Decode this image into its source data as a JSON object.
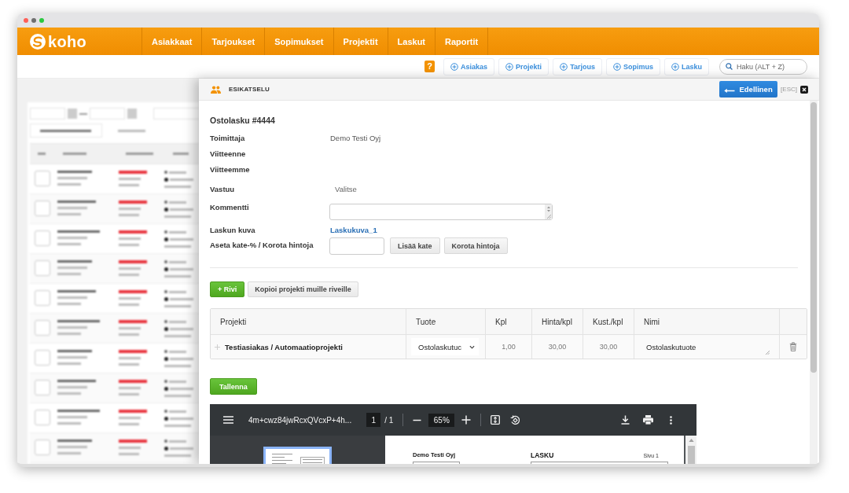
{
  "nav": {
    "logo": "koho",
    "items": [
      "Asiakkaat",
      "Tarjoukset",
      "Sopimukset",
      "Projektit",
      "Laskut",
      "Raportit"
    ]
  },
  "toolbar": {
    "help": "?",
    "quick_add": [
      "Asiakas",
      "Projekti",
      "Tarjous",
      "Sopimus",
      "Lasku"
    ],
    "search": {
      "placeholder": "Haku (ALT + Z)"
    }
  },
  "modal": {
    "title": "ESIKATSELU",
    "back_button": "Edellinen",
    "esc_hint": "[ESC]"
  },
  "form": {
    "heading": "Ostolasku #4444",
    "fields": [
      {
        "kind": "text",
        "label": "Toimittaja",
        "value": "Demo Testi Oyj"
      },
      {
        "kind": "text",
        "label": "Viitteenne"
      },
      {
        "kind": "text",
        "label": "Viitteemme"
      },
      {
        "kind": "select",
        "label": "Vastuu",
        "value": "Valitse"
      },
      {
        "kind": "textarea",
        "label": "Kommentti"
      },
      {
        "kind": "link",
        "label": "Laskun kuva",
        "value": "Laskukuva_1"
      },
      {
        "kind": "margin",
        "label": "Aseta kate-% / Korota hintoja",
        "buttons": [
          "Lisää kate",
          "Korota hintoja"
        ]
      }
    ]
  },
  "row_actions": {
    "add_row": "+ Rivi",
    "copy_project": "Kopioi projekti muille riveille"
  },
  "table": {
    "columns": [
      "Projekti",
      "Tuote",
      "Kpl",
      "Hinta/kpl",
      "Kust./kpl",
      "Nimi"
    ],
    "rows": [
      {
        "project": "Testiasiakas / Automaatioprojekti",
        "product": "Ostolaskutuc",
        "quantity": "1,00",
        "price": "30,00",
        "cost": "30,00",
        "name": "Ostolaskutuote"
      }
    ]
  },
  "save_button": "Tallenna",
  "pdf_viewer": {
    "filename": "4m+cwz84jwRcxQVcxP+4h...",
    "page": "1",
    "page_total": "/ 1",
    "zoom": "65%",
    "document": {
      "company": "Demo Testi Oyj",
      "title": "LASKU",
      "page_label": "Sivu 1"
    }
  }
}
